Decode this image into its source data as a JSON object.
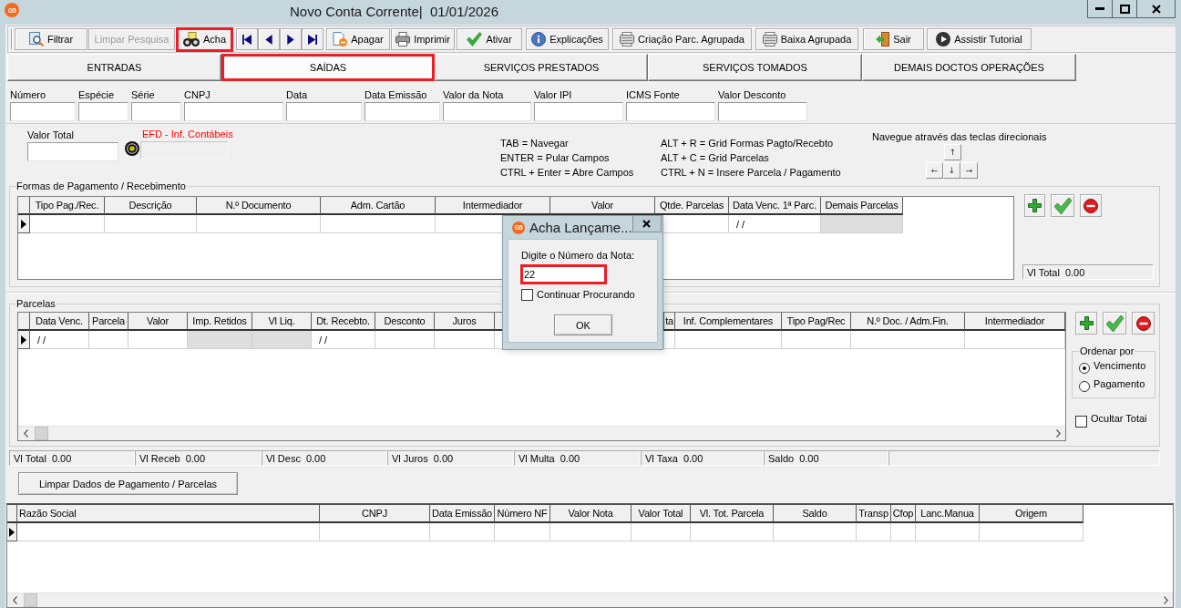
{
  "window": {
    "logo": "G5",
    "title": "Novo Conta Corrente|  01/01/2026"
  },
  "toolbar": [
    {
      "kind": "filter",
      "label": "Filtrar",
      "disabled": false,
      "highlighted": false
    },
    {
      "kind": "clear",
      "label": "Limpar Pesquisa",
      "disabled": true,
      "highlighted": false
    },
    {
      "kind": "find",
      "label": "Acha",
      "disabled": false,
      "highlighted": true
    },
    {
      "kind": "first",
      "disabled": false,
      "highlighted": false
    },
    {
      "kind": "prev",
      "disabled": false,
      "highlighted": false
    },
    {
      "kind": "next",
      "disabled": false,
      "highlighted": false
    },
    {
      "kind": "last",
      "disabled": false,
      "highlighted": false
    },
    {
      "kind": "delete",
      "label": "Apagar",
      "disabled": false,
      "highlighted": false
    },
    {
      "kind": "print",
      "label": "Imprimir",
      "disabled": false,
      "highlighted": false
    },
    {
      "kind": "activate",
      "label": "Ativar",
      "disabled": false,
      "highlighted": false
    },
    {
      "kind": "help",
      "label": "Explicações",
      "disabled": false,
      "highlighted": false
    },
    {
      "kind": "batch",
      "label": "Criação Parc. Agrupada",
      "disabled": false,
      "highlighted": false
    },
    {
      "kind": "settle",
      "label": "Baixa Agrupada",
      "disabled": false,
      "highlighted": false
    },
    {
      "kind": "exit",
      "label": "Sair",
      "disabled": false,
      "highlighted": false
    },
    {
      "kind": "tutorial",
      "label": "Assistir Tutorial",
      "disabled": false,
      "highlighted": false
    }
  ],
  "tabs": [
    {
      "label": "ENTRADAS",
      "selected": false,
      "highlighted": false
    },
    {
      "label": "SAÍDAS",
      "selected": true,
      "highlighted": true
    },
    {
      "label": "SERVIÇOS PRESTADOS",
      "selected": false,
      "highlighted": false
    },
    {
      "label": "SERVIÇOS TOMADOS",
      "selected": false,
      "highlighted": false
    },
    {
      "label": "DEMAIS DOCTOS OPERAÇÕES",
      "selected": false,
      "highlighted": false
    }
  ],
  "header_fields": [
    "Número",
    "Espécie",
    "Série",
    "CNPJ",
    "Data",
    "Data Emissão",
    "Valor da Nota",
    "Valor IPI",
    "ICMS Fonte",
    "Valor Desconto"
  ],
  "valor_total": {
    "label": "Valor Total"
  },
  "efd": {
    "label": "EFD - Inf. Contábeis",
    "disabled": true
  },
  "shortcuts": {
    "column_1": [
      "TAB = Navegar",
      "ENTER = Pular Campos",
      "CTRL + Enter = Abre Campos"
    ],
    "column_2": [
      "ALT + R = Grid Formas Pagto/Recebto",
      "ALT + C = Grid Parcelas",
      "CTRL + N = Insere Parcela / Pagamento"
    ]
  },
  "navigation": {
    "hint": "Navegue através das teclas direcionais",
    "keys": [
      "↑",
      "←",
      "↓",
      "→"
    ]
  },
  "formas": {
    "title": "Formas de Pagamento / Recebimento",
    "columns": [
      {
        "label": "Tipo Pag./Rec.",
        "disabled": false
      },
      {
        "label": "Descrição",
        "disabled": false
      },
      {
        "label": "N.º Documento",
        "disabled": false
      },
      {
        "label": "Adm. Cartão",
        "disabled": false
      },
      {
        "label": "Intermediador",
        "disabled": false
      },
      {
        "label": "Valor"
      },
      {
        "label": "Qtde. Parcelas",
        "disabled": false
      },
      {
        "label": "Data Venc. 1ª Parc.",
        "disabled": false
      },
      {
        "label": "Demais Parcelas",
        "disabled": true
      }
    ],
    "rows": [
      {
        "selected": true,
        "cells": [
          null,
          null,
          null,
          null,
          null,
          null,
          null,
          "/ /",
          null
        ]
      }
    ],
    "total": {
      "label": "Vl Total",
      "value": "0.00"
    }
  },
  "parcelas": {
    "title": "Parcelas",
    "columns": [
      {
        "label": "Data Venc.",
        "disabled": false
      },
      {
        "label": "Parcela",
        "disabled": false
      },
      {
        "label": "Valor",
        "disabled": false
      },
      {
        "label": "Imp. Retidos",
        "disabled": true
      },
      {
        "label": "Vl Liq.",
        "disabled": true
      },
      {
        "label": "Dt. Recebto.",
        "disabled": false
      },
      {
        "label": "Desconto",
        "disabled": false
      },
      {
        "label": "Juros",
        "disabled": false
      },
      {
        "label": "ta",
        "disabled": false
      },
      {
        "label": "Inf. Complementares",
        "disabled": false
      },
      {
        "label": "Tipo Pag/Rec",
        "disabled": false
      },
      {
        "label": "N.º Doc. / Adm.Fin.",
        "disabled": false
      },
      {
        "label": "Intermediador",
        "disabled": false
      }
    ],
    "rows": [
      {
        "selected": true,
        "cells": [
          "/ /",
          null,
          null,
          null,
          null,
          "/ /",
          null,
          null,
          null,
          null,
          null,
          null,
          null
        ]
      }
    ],
    "order": {
      "title": "Ordenar por",
      "options": [
        {
          "label": "Vencimento",
          "selected": true
        },
        {
          "label": "Pagamento",
          "selected": false
        }
      ]
    },
    "hide_totals": {
      "label": "Ocultar Totai",
      "checked": false
    }
  },
  "totals": [
    {
      "label": "Vl Total",
      "value": "0.00"
    },
    {
      "label": "Vl Receb",
      "value": "0.00"
    },
    {
      "label": "Vl Desc",
      "value": "0.00"
    },
    {
      "label": "Vl Juros",
      "value": "0.00"
    },
    {
      "label": "Vl Multa",
      "value": "0.00"
    },
    {
      "label": "Vl Taxa",
      "value": "0.00"
    },
    {
      "label": "Saldo",
      "value": "0.00"
    }
  ],
  "clear_button": "Limpar Dados de Pagamento / Parcelas",
  "lancamentos": {
    "columns": [
      {
        "label": "Razão Social"
      },
      {
        "label": "CNPJ"
      },
      {
        "label": "Data Emissão"
      },
      {
        "label": "Número NF"
      },
      {
        "label": "Valor Nota"
      },
      {
        "label": "Valor Total"
      },
      {
        "label": "Vl. Tot. Parcela"
      },
      {
        "label": "Saldo"
      },
      {
        "label": "Transp"
      },
      {
        "label": "Cfop"
      },
      {
        "label": "Lanc.Manua"
      },
      {
        "label": "Origem"
      }
    ],
    "rows": [
      {
        "selected": true
      }
    ]
  },
  "dialog": {
    "logo": "G5",
    "title": "Acha Lançame...",
    "prompt": "Digite o Número da Nota:",
    "value": "22",
    "highlighted": true,
    "continue": {
      "label": "Continuar Procurando",
      "checked": false
    },
    "button": "OK"
  }
}
